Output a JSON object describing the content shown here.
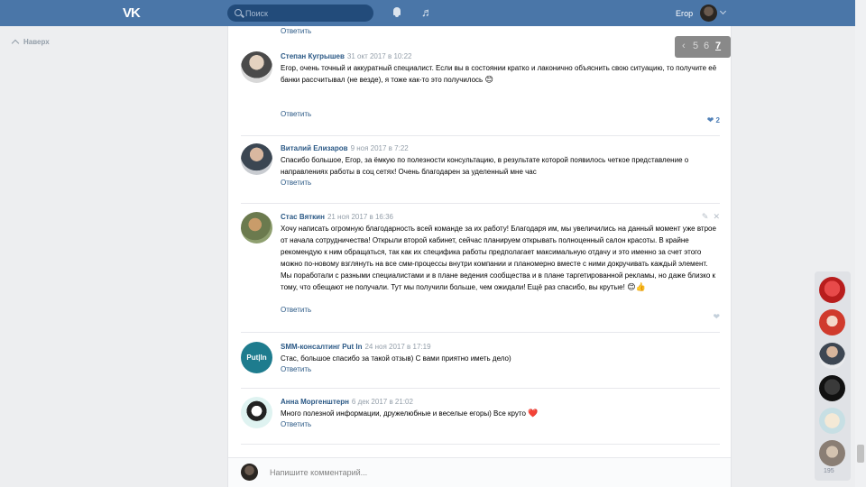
{
  "header": {
    "logo": "VK",
    "search_placeholder": "Поиск",
    "user_name": "Егор"
  },
  "sidebar": {
    "up_label": "Наверх"
  },
  "pager": {
    "pages": [
      "‹",
      "5",
      "6",
      "7"
    ]
  },
  "top_reply": "Ответить",
  "comments": [
    {
      "author": "Степан Кугрышев",
      "date": "31 окт 2017 в 10:22",
      "text": "Егор, очень точный и аккуратный специалист. Если вы в состоянии кратко и лаконично объяснить свою ситуацию, то получите её банки рассчитывал (не везде), я тоже как-то это получилось",
      "reply": "Ответить",
      "likes": "2",
      "emoji": "😊"
    },
    {
      "author": "Виталий Елизаров",
      "date": "9 ноя 2017 в 7:22",
      "text": "Спасибо большое, Егор, за ёмкую по полезности консультацию, в результате которой появилось четкое представление о направлениях работы в соц сетях! Очень благодарен за уделенный мне час",
      "reply": "Ответить"
    },
    {
      "author": "Стас Вяткин",
      "date": "21 ноя 2017 в 16:36",
      "text": "Хочу написать огромную благодарность всей команде за их работу! Благодаря им, мы увеличились на данный момент уже втрое от начала сотрудничества! Открыли второй кабинет, сейчас планируем открывать полноценный салон красоты. В крайне рекомендую к ним обращаться, так как их специфика работы предполагает максимальную отдачу и это именно за счет этого можно по-новому взглянуть на все смм-процессы внутри компании и планомерно вместе с ними докручивать каждый элемент. Мы поработали с разными специалистами и в плане ведения сообщества и в плане таргетированной рекламы, но даже близко к тому, что обещают не получали. Тут мы получили больше, чем ожидали! Ещё раз спасибо, вы крутые!",
      "reply": "Ответить",
      "emoji": "😊👍"
    },
    {
      "author": "SMM-консалтинг Put In",
      "date": "24 ноя 2017 в 17:19",
      "text": "Стас, большое спасибо за такой отзыв) С вами приятно иметь дело)",
      "reply": "Ответить",
      "avatar_text": "Put|In"
    },
    {
      "author": "Анна Моргенштерн",
      "date": "6 дек 2017 в 21:02",
      "text": "Много полезной информации, дружелюбные и веселые егоры) Все круто",
      "reply": "Ответить",
      "emoji": "❤️"
    }
  ],
  "composer": {
    "placeholder": "Напишите комментарий..."
  },
  "right_stack": {
    "count": "195"
  },
  "colors": {
    "header": "#4a76a8",
    "link": "#2a5885",
    "meta": "#939ea9"
  }
}
